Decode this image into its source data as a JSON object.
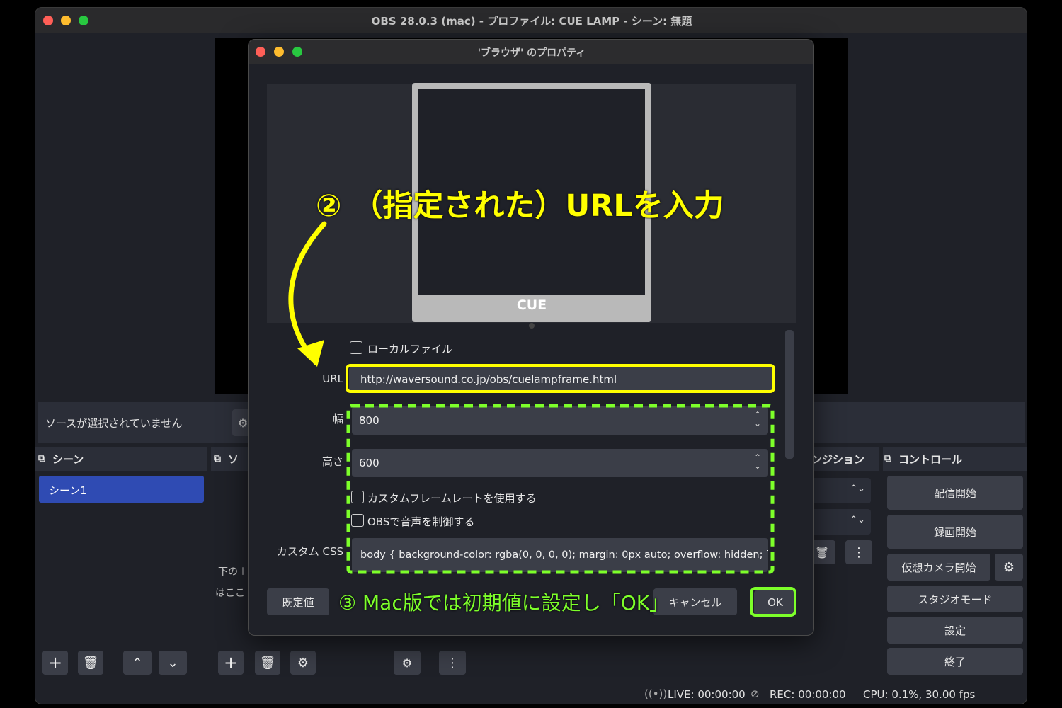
{
  "window": {
    "title": "OBS 28.0.3 (mac) - プロファイル: CUE LAMP - シーン: 無題"
  },
  "source_bar": {
    "no_source_text": "ソースが選択されていません"
  },
  "scenes": {
    "header": "シーン",
    "items": [
      {
        "label": "シーン1"
      }
    ]
  },
  "sources": {
    "header": "ソ",
    "hint_line1": "下の＋",
    "hint_line2": "はここ"
  },
  "transitions": {
    "header": "ンジション"
  },
  "controls": {
    "header": "コントロール",
    "buttons": [
      "配信開始",
      "録画開始",
      "仮想カメラ開始",
      "スタジオモード",
      "設定",
      "終了"
    ]
  },
  "status_bar": {
    "live": "LIVE: 00:00:00",
    "rec": "REC: 00:00:00",
    "cpu": "CPU: 0.1%, 30.00 fps"
  },
  "dialog": {
    "title": "'ブラウザ' のプロパティ",
    "preview_label": "CUE",
    "local_file_label": "ローカルファイル",
    "url_label": "URL",
    "url_value": "http://waversound.co.jp/obs/cuelampframe.html",
    "width_label": "幅",
    "width_value": "800",
    "height_label": "高さ",
    "height_value": "600",
    "custom_fps_label": "カスタムフレームレートを使用する",
    "audio_label": "OBSで音声を制御する",
    "css_label": "カスタム CSS",
    "css_value": "body { background-color: rgba(0, 0, 0, 0); margin: 0px auto; overflow: hidden; }",
    "defaults_button": "既定値",
    "cancel_button": "キャンセル",
    "ok_button": "OK"
  },
  "annotations": {
    "step2": "② （指定された）URLを入力",
    "step3": "③ Mac版では初期値に設定し「OK」",
    "colors": {
      "step2": "#ffff00",
      "step3": "#7dff2a"
    }
  }
}
